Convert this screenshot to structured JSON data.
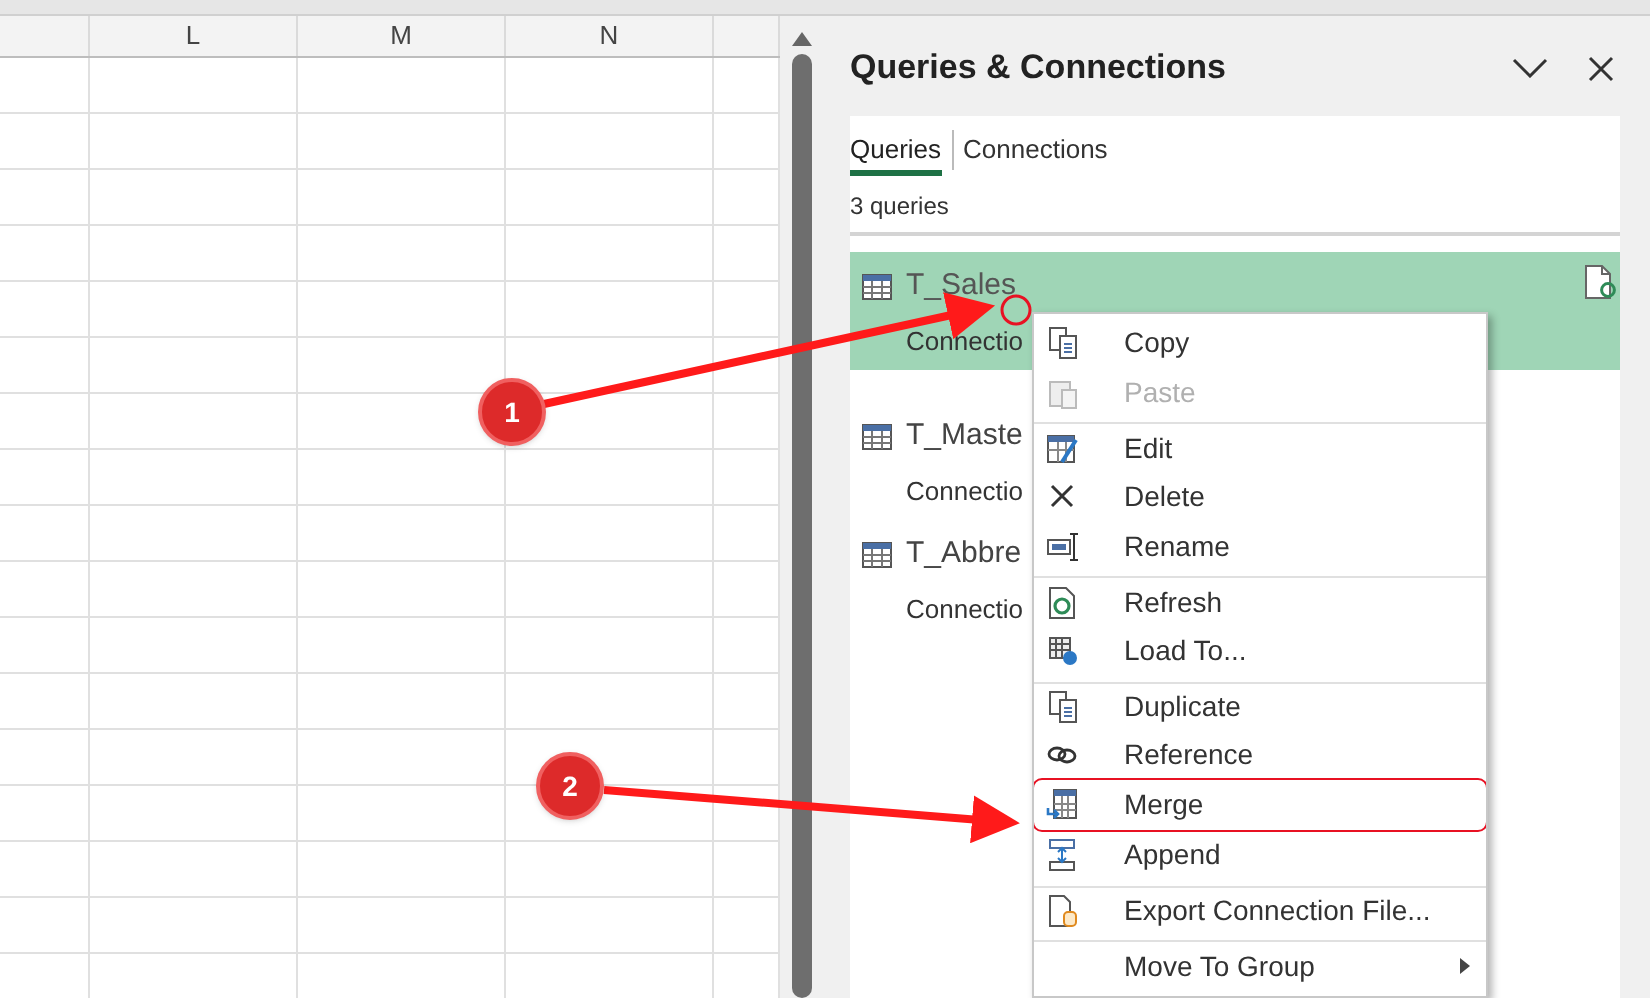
{
  "sheet": {
    "columns": [
      "",
      "L",
      "M",
      "N",
      ""
    ]
  },
  "panel": {
    "title": "Queries & Connections",
    "tabs": [
      {
        "label": "Queries",
        "selected": true
      },
      {
        "label": "Connections",
        "selected": false
      }
    ],
    "count": "3 queries",
    "queries": [
      {
        "name": "T_Sales",
        "detail": "Connectio",
        "selected": true
      },
      {
        "name": "T_Maste",
        "detail": "Connectio",
        "selected": false
      },
      {
        "name": "T_Abbre",
        "detail": "Connectio",
        "selected": false
      }
    ]
  },
  "context_menu": [
    {
      "label": "Copy",
      "disabled": false,
      "separator_before": false,
      "highlighted": false,
      "submenu": false
    },
    {
      "label": "Paste",
      "disabled": true,
      "separator_before": false,
      "highlighted": false,
      "submenu": false
    },
    {
      "label": "Edit",
      "disabled": false,
      "separator_before": true,
      "highlighted": false,
      "submenu": false
    },
    {
      "label": "Delete",
      "disabled": false,
      "separator_before": false,
      "highlighted": false,
      "submenu": false
    },
    {
      "label": "Rename",
      "disabled": false,
      "separator_before": false,
      "highlighted": false,
      "submenu": false
    },
    {
      "label": "Refresh",
      "disabled": false,
      "separator_before": true,
      "highlighted": false,
      "submenu": false
    },
    {
      "label": "Load To...",
      "disabled": false,
      "separator_before": false,
      "highlighted": false,
      "submenu": false
    },
    {
      "label": "Duplicate",
      "disabled": false,
      "separator_before": true,
      "highlighted": false,
      "submenu": false
    },
    {
      "label": "Reference",
      "disabled": false,
      "separator_before": false,
      "highlighted": false,
      "submenu": false
    },
    {
      "label": "Merge",
      "disabled": false,
      "separator_before": false,
      "highlighted": true,
      "submenu": false
    },
    {
      "label": "Append",
      "disabled": false,
      "separator_before": false,
      "highlighted": false,
      "submenu": false
    },
    {
      "label": "Export Connection File...",
      "disabled": false,
      "separator_before": true,
      "highlighted": false,
      "submenu": false
    },
    {
      "label": "Move To Group",
      "disabled": false,
      "separator_before": true,
      "highlighted": false,
      "submenu": true
    }
  ],
  "annotations": [
    {
      "label": "1"
    },
    {
      "label": "2"
    }
  ]
}
